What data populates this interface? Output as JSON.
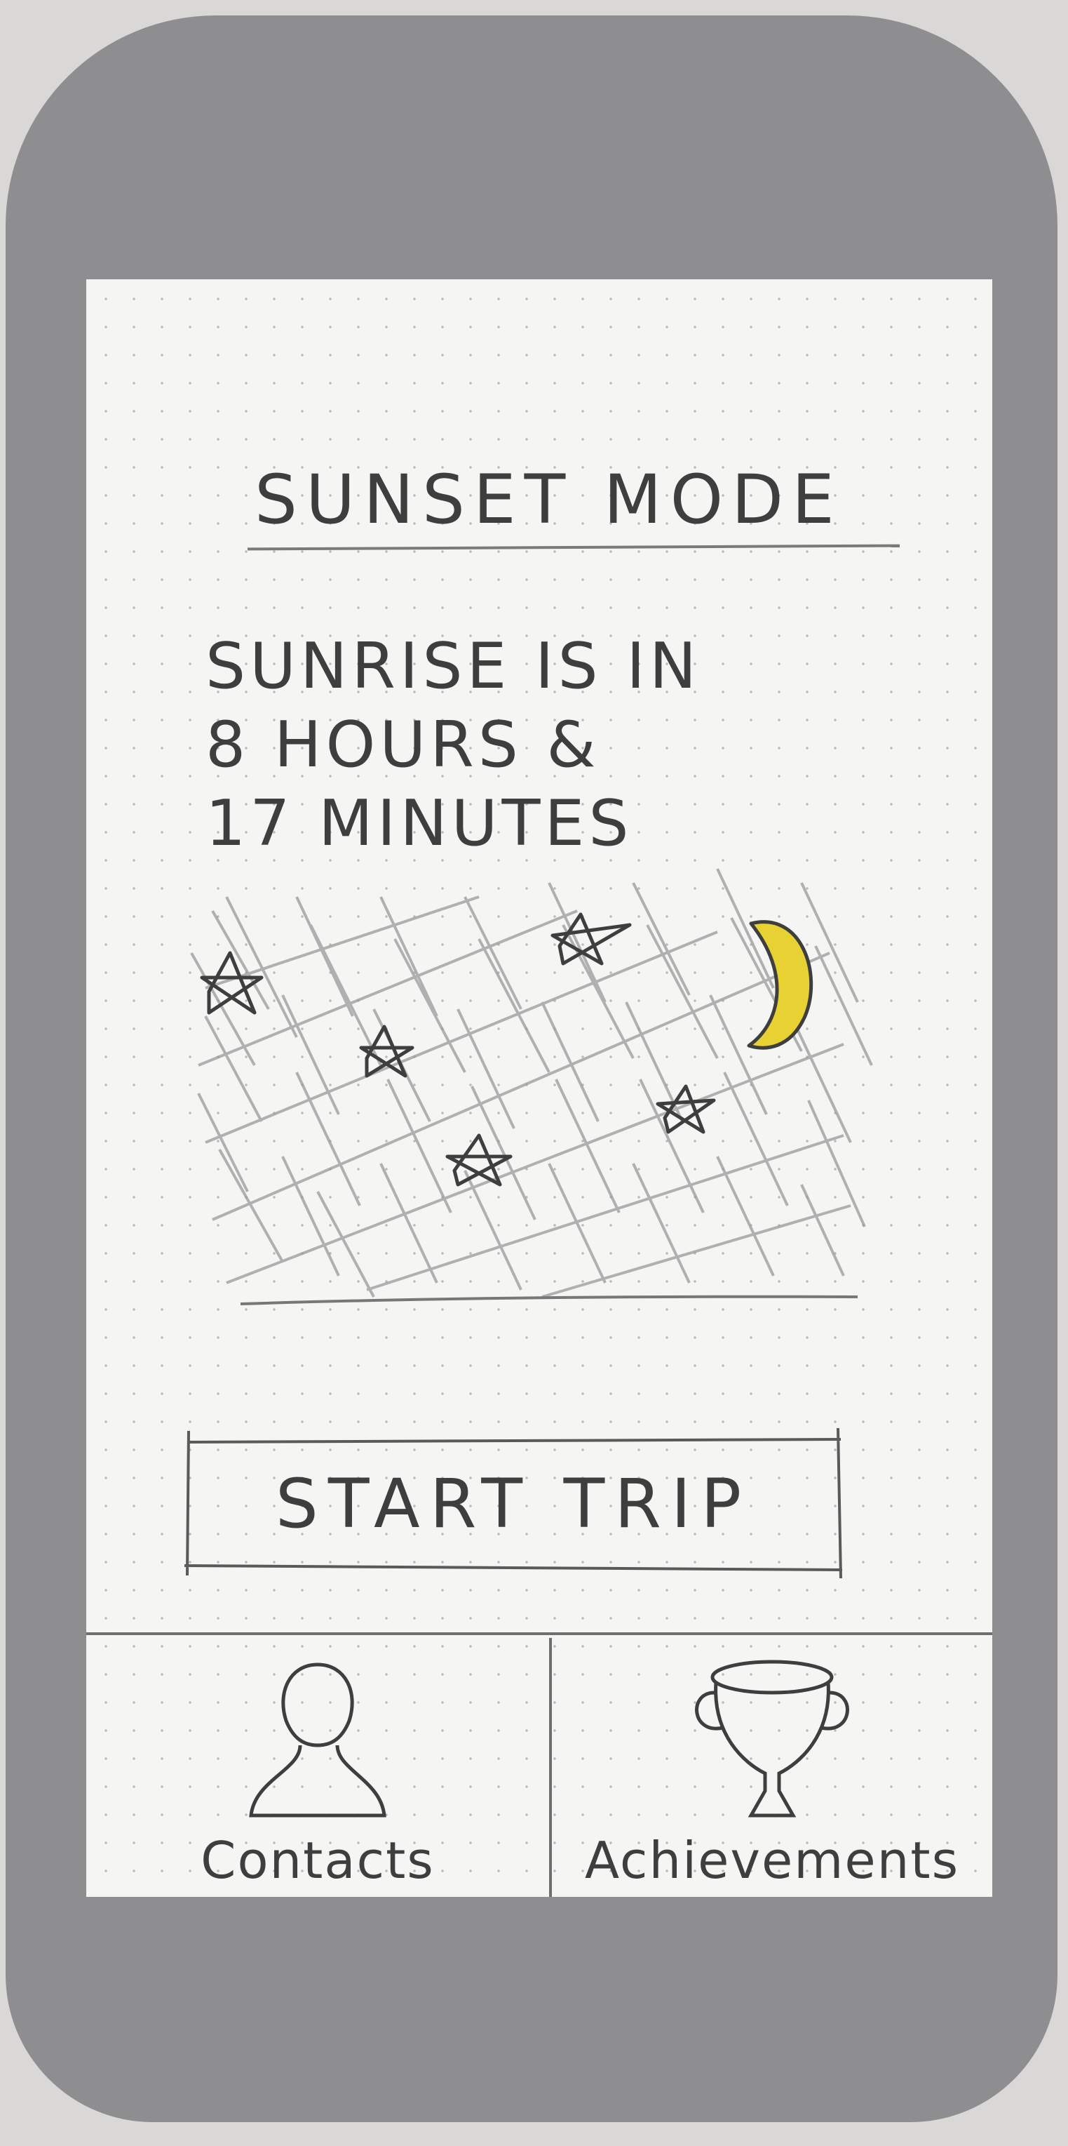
{
  "screen": {
    "title": "SUNSET MODE",
    "countdown": {
      "line1": "SUNRISE IS IN",
      "line2": "8 HOURS &",
      "line3": "17 MINUTES"
    },
    "start_button_label": "START TRIP"
  },
  "bottom_nav": {
    "items": [
      {
        "label": "Contacts",
        "icon": "person-icon"
      },
      {
        "label": "Achievements",
        "icon": "trophy-icon"
      }
    ]
  },
  "colors": {
    "frame": "#8e8e90",
    "paper": "#f5f5f3",
    "pencil": "#3e3e3e",
    "moon": "#e8d233"
  }
}
